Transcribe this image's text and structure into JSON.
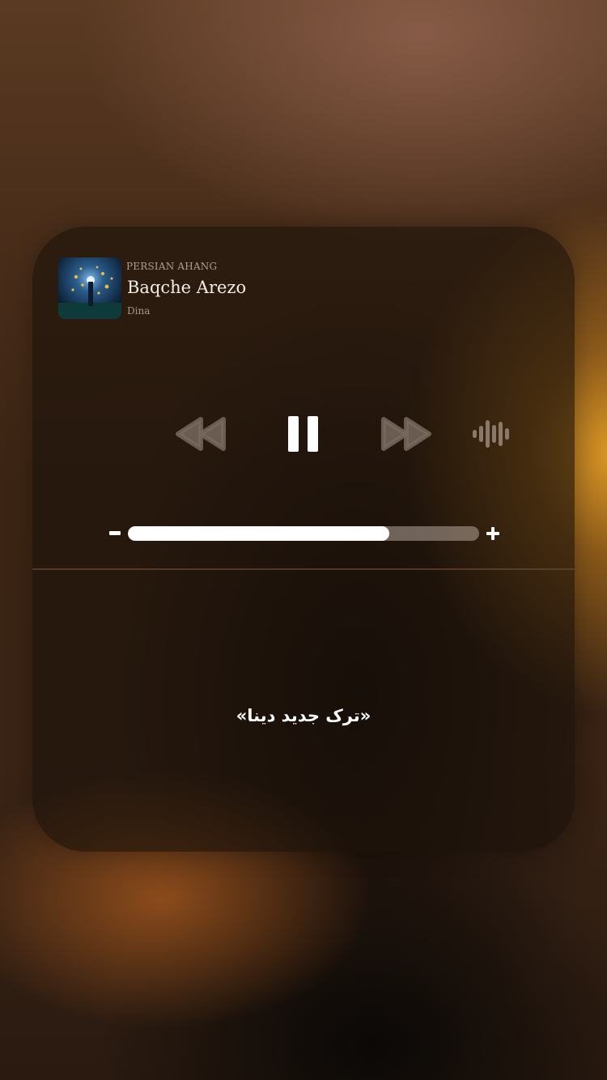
{
  "now_playing": {
    "source": "PERSIAN AHANG",
    "title": "Baqche Arezo",
    "artist": "Dina",
    "artwork_icon": "album-artwork"
  },
  "controls": {
    "rewind_icon": "rewind-icon",
    "pause_icon": "pause-icon",
    "forward_icon": "fast-forward-icon",
    "audio_output_icon": "audio-waveform-icon"
  },
  "volume": {
    "level": 0.745,
    "minus_icon": "volume-minus-icon",
    "plus_icon": "volume-plus-icon"
  },
  "caption": "«ترک جدید دینا»",
  "colors": {
    "accent_glow": "#e0a030",
    "card_bg": "#1c110a",
    "fill": "#ffffff"
  }
}
